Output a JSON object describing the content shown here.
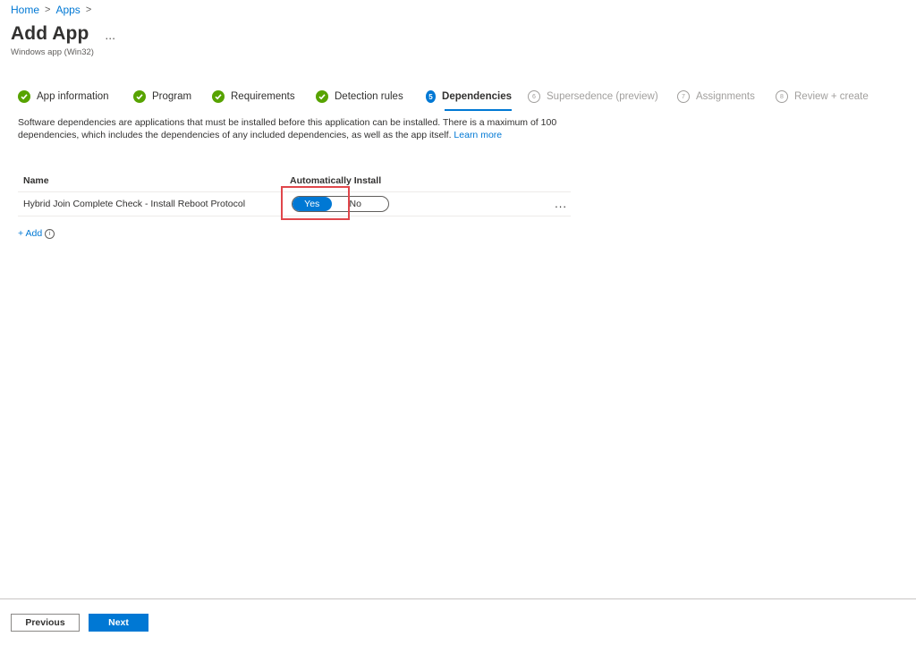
{
  "breadcrumb": {
    "home": "Home",
    "apps": "Apps",
    "separator": ">"
  },
  "header": {
    "title": "Add App",
    "more": "...",
    "subtitle": "Windows app (Win32)"
  },
  "wizard": {
    "steps": [
      {
        "label": "App information",
        "state": "done"
      },
      {
        "label": "Program",
        "state": "done"
      },
      {
        "label": "Requirements",
        "state": "done"
      },
      {
        "label": "Detection rules",
        "state": "done"
      },
      {
        "number": "5",
        "label": "Dependencies",
        "state": "active"
      },
      {
        "number": "6",
        "label": "Supersedence (preview)",
        "state": "future"
      },
      {
        "number": "7",
        "label": "Assignments",
        "state": "future"
      },
      {
        "number": "8",
        "label": "Review + create",
        "state": "future"
      }
    ]
  },
  "description": {
    "text": "Software dependencies are applications that must be installed before this application can be installed. There is a maximum of 100 dependencies, which includes the dependencies of any included dependencies, as well as the app itself.",
    "link": "Learn more"
  },
  "grid": {
    "headers": {
      "name": "Name",
      "auto_install": "Automatically Install"
    },
    "rows": [
      {
        "name": "Hybrid Join Complete Check - Install Reboot Protocol",
        "yes": "Yes",
        "no": "No",
        "selected": "Yes",
        "more": "..."
      }
    ]
  },
  "add": {
    "label": "+ Add",
    "info": "i"
  },
  "footer": {
    "previous": "Previous",
    "next": "Next"
  },
  "colors": {
    "accent": "#0078d4",
    "success": "#57a300",
    "highlight": "#e0464b"
  }
}
